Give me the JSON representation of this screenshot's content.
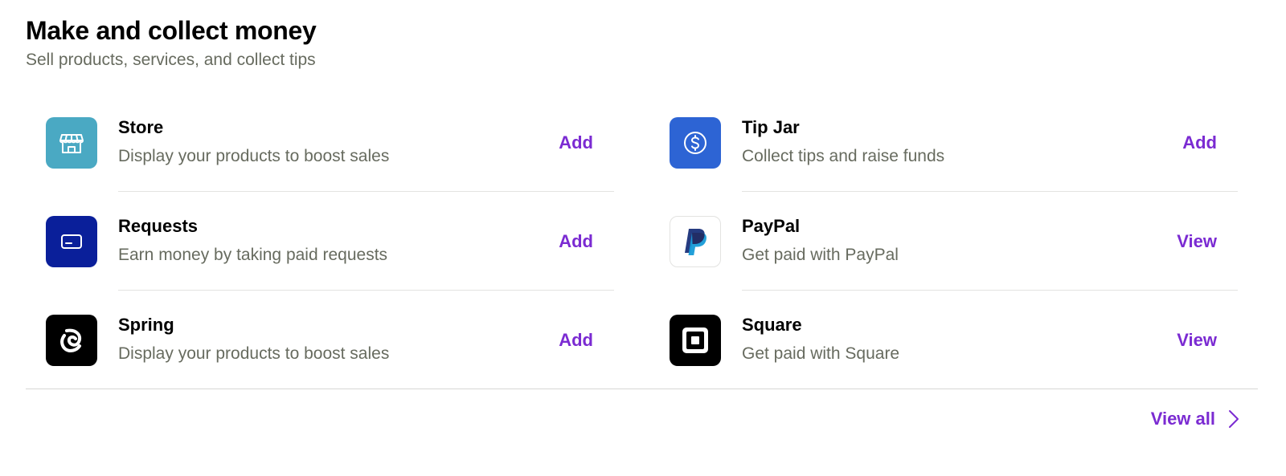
{
  "section": {
    "title": "Make and collect money",
    "subtitle": "Sell products, services, and collect tips"
  },
  "left_items": [
    {
      "name": "Store",
      "description": "Display your products to boost sales",
      "action": "Add",
      "icon": "store-icon",
      "icon_bg": "#4aa9c3"
    },
    {
      "name": "Requests",
      "description": "Earn money by taking paid requests",
      "action": "Add",
      "icon": "credit-card-icon",
      "icon_bg": "#0a1f9a"
    },
    {
      "name": "Spring",
      "description": "Display your products to boost sales",
      "action": "Add",
      "icon": "spring-logo-icon",
      "icon_bg": "#000000"
    }
  ],
  "right_items": [
    {
      "name": "Tip Jar",
      "description": "Collect tips and raise funds",
      "action": "Add",
      "icon": "dollar-circle-icon",
      "icon_bg": "#2d64d4"
    },
    {
      "name": "PayPal",
      "description": "Get paid with PayPal",
      "action": "View",
      "icon": "paypal-logo-icon",
      "icon_bg": "#ffffff"
    },
    {
      "name": "Square",
      "description": "Get paid with Square",
      "action": "View",
      "icon": "square-logo-icon",
      "icon_bg": "#000000"
    }
  ],
  "footer": {
    "view_all_label": "View all",
    "icon": "chevron-right-icon"
  },
  "colors": {
    "accent": "#7b2bd2",
    "muted_text": "#676b5f",
    "divider": "#e3e3e1"
  }
}
